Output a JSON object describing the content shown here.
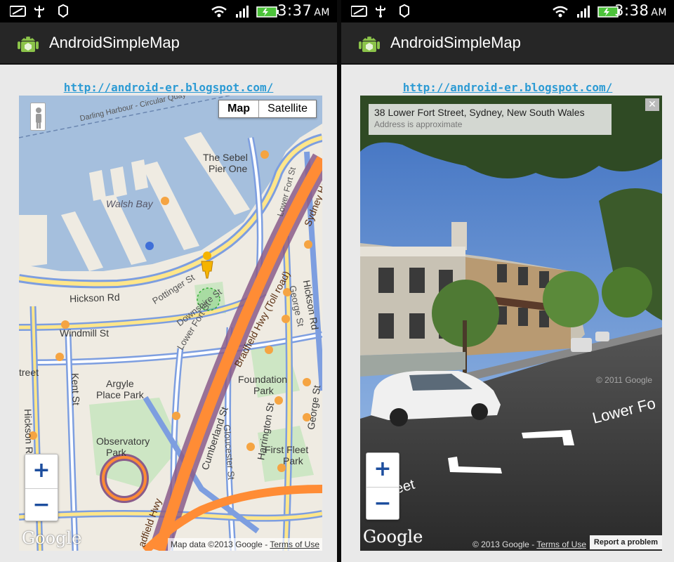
{
  "left": {
    "status_time": "3:37",
    "status_ampm": "AM",
    "app_title": "AndroidSimpleMap",
    "blog_link": "http://android-er.blogspot.com/",
    "maptype_map": "Map",
    "maptype_satellite": "Satellite",
    "zoom_in": "+",
    "zoom_out": "−",
    "google_logo": "Google",
    "attribution_data": "Map data ©2013 Google",
    "attribution_separator": " - ",
    "terms": "Terms of Use",
    "map_labels": {
      "darling_harbour": "Darling Harbour - Circular Quay",
      "sebel_pier": "The Sebel",
      "sebel_pier2": "Pier One",
      "walsh_bay": "Walsh Bay",
      "hickson_rd": "Hickson Rd",
      "pottinger": "Pottinger St",
      "downshire": "Downshire St",
      "lower_fort": "Lower Fort St",
      "lower_fort2": "Lower Fort St",
      "windmill": "Windmill St",
      "bradfield": "Bradfield Hwy (Toll road)",
      "sydney_hwy": "Sydney Harb",
      "hickson_rd_right": "Hickson Rd",
      "george_st": "George St",
      "george_st2": "George St",
      "kent_st": "Kent St",
      "argyle": "Argyle",
      "argyle2": "Place Park",
      "foundation": "Foundation",
      "foundation2": "Park",
      "observatory": "Observatory",
      "observatory2": "Park",
      "cumberland": "Cumberland St",
      "gloucester": "Gloucester St",
      "harrington": "Harrington St",
      "first_fleet": "First Fleet",
      "first_fleet2": "Park",
      "hickson_left": "Hickson R",
      "street_left": "treet",
      "bradfield_bottom": "adfield Hwy",
      "lower_fort_top": "Lower Fort St"
    }
  },
  "right": {
    "status_time": "3:38",
    "status_ampm": "AM",
    "app_title": "AndroidSimpleMap",
    "blog_link": "http://android-er.blogspot.com/",
    "address": "38 Lower Fort Street, Sydney, New South Wales",
    "address_note": "Address is approximate",
    "close": "✕",
    "zoom_in": "+",
    "zoom_out": "−",
    "google_logo": "Google",
    "copyright": "© 2013 Google",
    "attribution_separator": " - ",
    "terms": "Terms of Use",
    "report": "Report a problem",
    "street_label": "Lower Fo",
    "street_label2": "eet",
    "watermark": "© 2011 Google"
  },
  "colors": {
    "water": "#a5bfdd",
    "land": "#efebe2",
    "park": "#cde6c4",
    "road_major": "#ff8c35",
    "road_minor": "#fff",
    "road_blue": "#7d9ee0",
    "road_yellow": "#ffe68a",
    "action_bar": "#262626",
    "link": "#2d9bd4"
  }
}
